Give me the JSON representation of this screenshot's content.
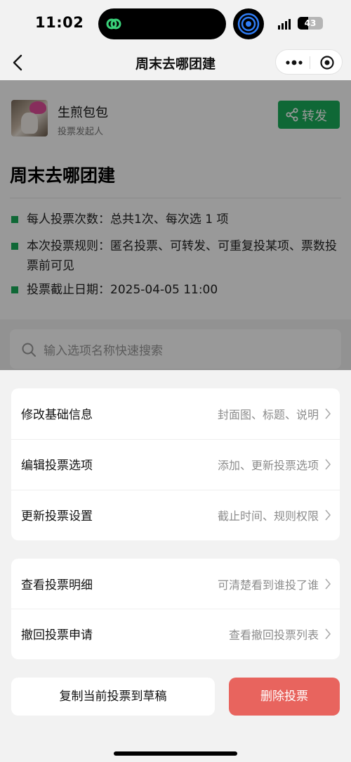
{
  "status_bar": {
    "time": "11:02",
    "battery": "43"
  },
  "nav": {
    "title": "周末去哪团建"
  },
  "creator": {
    "name": "生煎包包",
    "role": "投票发起人"
  },
  "forward_button": {
    "label": "转发"
  },
  "vote": {
    "title": "周末去哪团建",
    "info": [
      "每人投票次数：总共1次、每次选 1 项",
      "本次投票规则：匿名投票、可转发、可重复投某项、票数投票前可见",
      "投票截止日期：2025-04-05 11:00"
    ]
  },
  "search": {
    "placeholder": "输入选项名称快速搜索"
  },
  "sheet": {
    "group1": [
      {
        "label": "修改基础信息",
        "hint": "封面图、标题、说明"
      },
      {
        "label": "编辑投票选项",
        "hint": "添加、更新投票选项"
      },
      {
        "label": "更新投票设置",
        "hint": "截止时间、规则权限"
      }
    ],
    "group2": [
      {
        "label": "查看投票明细",
        "hint": "可清楚看到谁投了谁"
      },
      {
        "label": "撤回投票申请",
        "hint": "查看撤回投票列表"
      }
    ],
    "copy_label": "复制当前投票到草稿",
    "delete_label": "删除投票"
  },
  "colors": {
    "accent_green": "#1aad5a",
    "danger": "#e8645e"
  }
}
